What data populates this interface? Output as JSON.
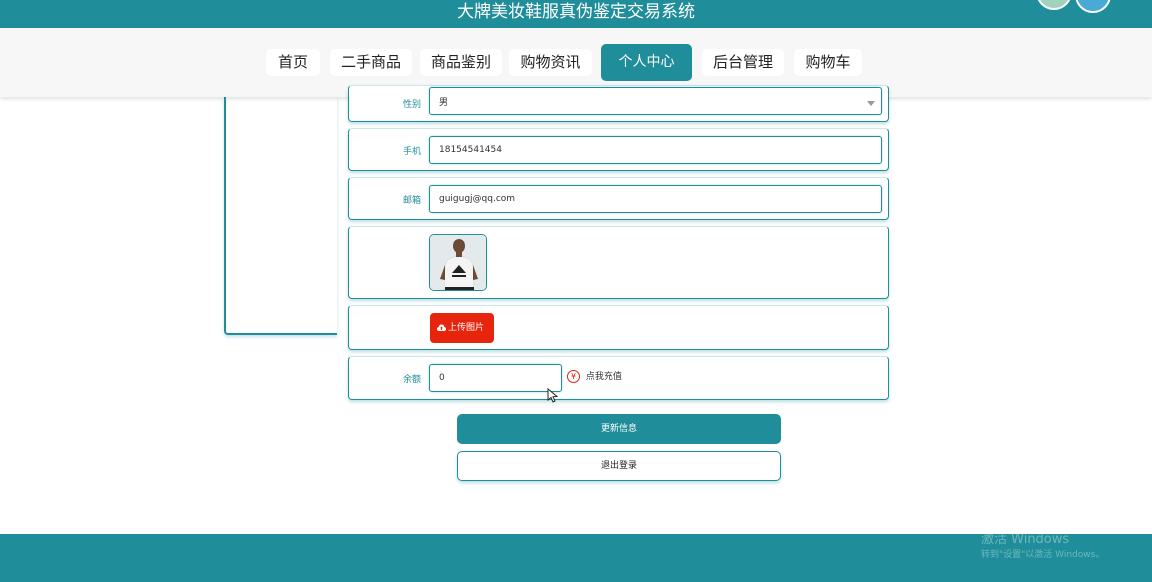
{
  "header": {
    "site_title": "大牌美妆鞋服真伪鉴定交易系统"
  },
  "nav": {
    "items": [
      {
        "label": "首页"
      },
      {
        "label": "二手商品"
      },
      {
        "label": "商品鉴别"
      },
      {
        "label": "购物资讯"
      },
      {
        "label": "个人中心",
        "active": true
      },
      {
        "label": "后台管理"
      },
      {
        "label": "购物车"
      }
    ]
  },
  "form": {
    "gender": {
      "label": "性别",
      "value": "男"
    },
    "phone": {
      "label": "手机",
      "value": "18154541454"
    },
    "email": {
      "label": "邮箱",
      "value": "guigugj@qq.com"
    },
    "upload": {
      "label": "上传图片"
    },
    "balance": {
      "label": "余额",
      "value": "0",
      "recharge_label": "点我充值",
      "recharge_icon": "¥"
    }
  },
  "actions": {
    "update_label": "更新信息",
    "logout_label": "退出登录"
  },
  "watermark": {
    "line1": "激活 Windows",
    "line2": "转到\"设置\"以激活 Windows。"
  },
  "colors": {
    "primary": "#1f8e9a",
    "upload": "#e6250c"
  }
}
